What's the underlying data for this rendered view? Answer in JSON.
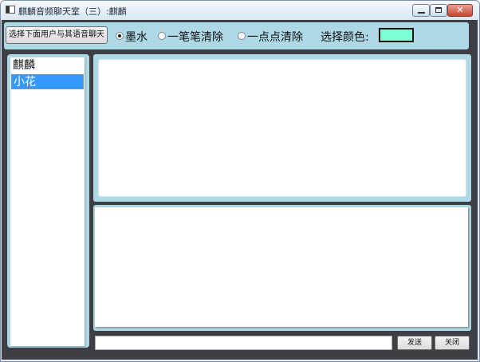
{
  "window": {
    "title": "麒麟音频聊天室（三）:麒麟",
    "close_glyph": "✕"
  },
  "toolbar": {
    "select_user_button": "选择下面用户与其语音聊天",
    "mode_options": [
      {
        "label": "墨水",
        "selected": true
      },
      {
        "label": "一笔笔清除",
        "selected": false
      },
      {
        "label": "一点点清除",
        "selected": false
      }
    ],
    "color_label": "选择颜色:",
    "selected_color": "#7fffd4"
  },
  "users": [
    {
      "name": "麒麟",
      "selected": false
    },
    {
      "name": "小花",
      "selected": true
    }
  ],
  "footer": {
    "message_input_value": "",
    "send_label": "发送",
    "close_label": "关闭"
  }
}
